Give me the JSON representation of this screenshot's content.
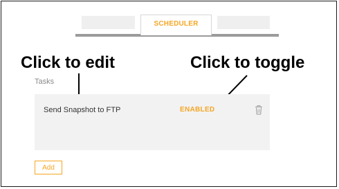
{
  "tabs": {
    "left_label": "",
    "active_label": "SCHEDULER",
    "right_label": ""
  },
  "annotations": {
    "left_callout": "Click to edit",
    "right_callout": "Click to toggle"
  },
  "tasks_section": {
    "label": "Tasks",
    "items": [
      {
        "name": "Send Snapshot to FTP",
        "status": "ENABLED",
        "action_icon": "trash-icon"
      }
    ]
  },
  "add_button_label": "Add",
  "colors": {
    "accent": "#f5a623",
    "panel": "#f2f2f2",
    "tab_inactive": "#efefef",
    "tab_underline": "#9b9b9b"
  }
}
